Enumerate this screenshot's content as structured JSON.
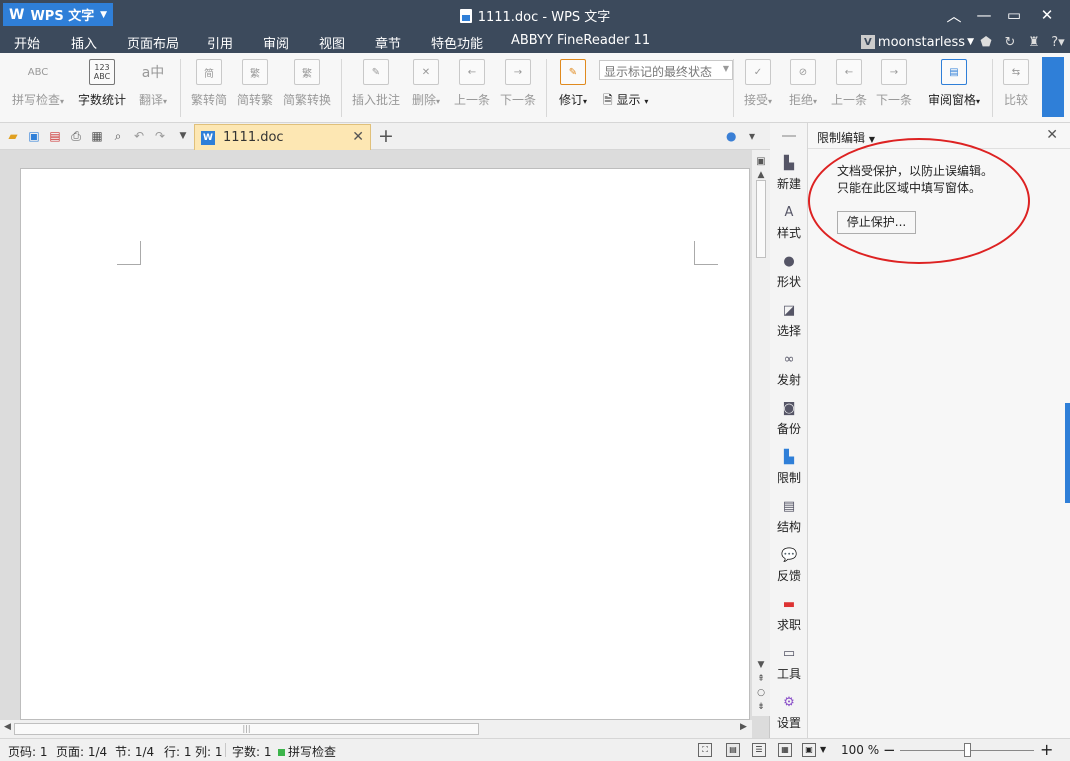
{
  "titlebar": {
    "app_name": "WPS 文字",
    "window_title": "1111.doc - WPS 文字"
  },
  "menu": {
    "items": [
      "开始",
      "插入",
      "页面布局",
      "引用",
      "审阅",
      "视图",
      "章节",
      "特色功能",
      "ABBYY FineReader 11"
    ],
    "active": "审阅",
    "user": "moonstarless"
  },
  "ribbon": {
    "spell_check": "拼写检查",
    "word_count": "字数统计",
    "translate": "翻译",
    "trad_to_simp": "繁转简",
    "simp_to_trad": "简转繁",
    "simp_trad_convert": "简繁转换",
    "insert_comment": "插入批注",
    "delete": "删除",
    "prev_comment": "上一条",
    "next_comment": "下一条",
    "track_changes": "修订",
    "markup_select": "显示标记的最终状态",
    "show": "显示",
    "accept": "接受",
    "reject": "拒绝",
    "prev_change": "上一条",
    "next_change": "下一条",
    "review_pane": "审阅窗格",
    "compare": "比较",
    "icon_abc": "ABC",
    "icon_123": "123\nABC",
    "icon_trad": "简",
    "icon_simp": "繁"
  },
  "tabs": {
    "doc_tab": "1111.doc",
    "doc_icon_letter": "W"
  },
  "side_strip": {
    "items": [
      "新建",
      "样式",
      "形状",
      "选择",
      "发射",
      "备份",
      "限制",
      "结构",
      "反馈",
      "求职",
      "工具",
      "设置"
    ]
  },
  "panel": {
    "title": "限制编辑",
    "message_line1": "文档受保护，以防止误编辑。",
    "message_line2": "只能在此区域中填写窗体。",
    "stop_protection": "停止保护..."
  },
  "status": {
    "page": "页码: 1",
    "pages": "页面: 1/4",
    "section": "节: 1/4",
    "row": "行: 1",
    "col": "列: 1",
    "words": "字数: 1",
    "spell": "拼写检查",
    "zoom": "100 %"
  },
  "colors": {
    "titlebar_bg": "#3c4a5c",
    "accent": "#2f7fd8",
    "annotation_red": "#d22222",
    "doc_tab_bg": "#fde7b3"
  }
}
